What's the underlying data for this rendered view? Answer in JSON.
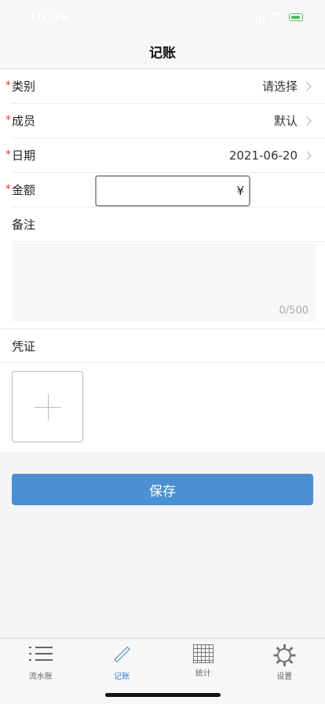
{
  "status_bar": {
    "time": "10:09"
  },
  "nav": {
    "title": "记账"
  },
  "form": {
    "category": {
      "label": "类别",
      "value": "请选择",
      "required": "*"
    },
    "member": {
      "label": "成员",
      "value": "默认",
      "required": "*"
    },
    "date": {
      "label": "日期",
      "value": "2021-06-20",
      "required": "*"
    },
    "amount": {
      "label": "金额",
      "value": "",
      "currency": "¥",
      "required": "*"
    },
    "remark": {
      "label": "备注",
      "value": "",
      "counter": "0/500"
    },
    "voucher": {
      "label": "凭证"
    }
  },
  "save_label": "保存",
  "tabs": [
    {
      "label": "流水账",
      "icon": "list-icon",
      "active": false
    },
    {
      "label": "记账",
      "icon": "pencil-icon",
      "active": true
    },
    {
      "label": "统计",
      "icon": "grid-icon",
      "active": false
    },
    {
      "label": "设置",
      "icon": "gear-icon",
      "active": false
    }
  ],
  "colors": {
    "accent": "#4a90d2",
    "required": "#e33333",
    "active_tab": "#3a7bd5"
  }
}
